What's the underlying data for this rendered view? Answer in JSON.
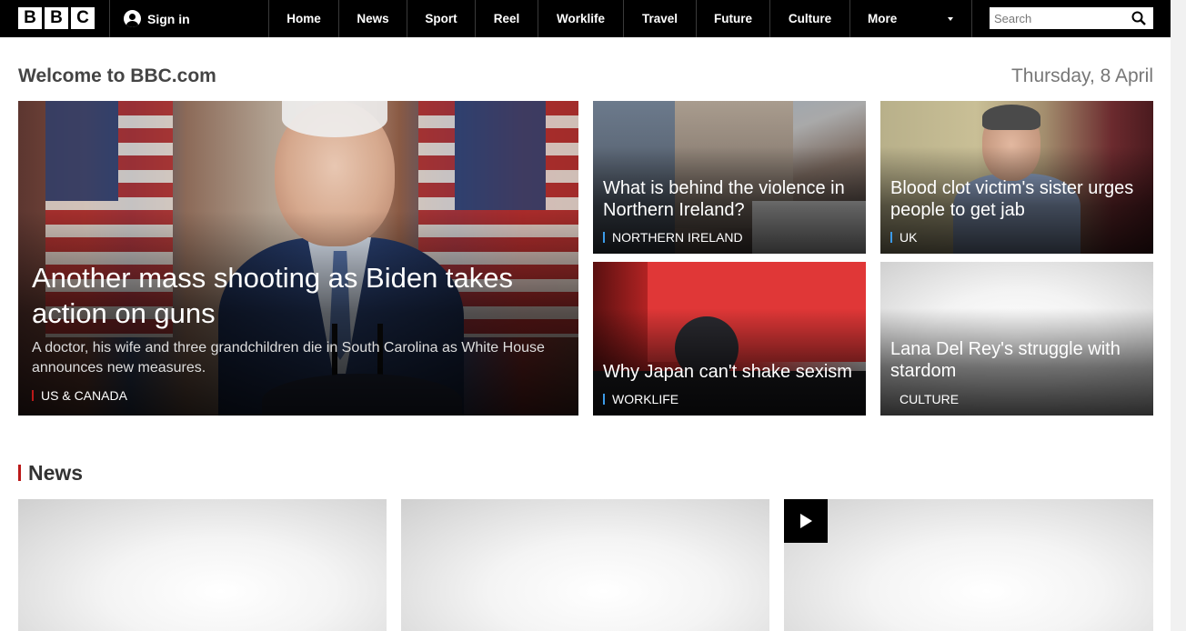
{
  "header": {
    "logo_letters": [
      "B",
      "B",
      "C"
    ],
    "signin_label": "Sign in",
    "nav": [
      "Home",
      "News",
      "Sport",
      "Reel",
      "Worklife",
      "Travel",
      "Future",
      "Culture",
      "More"
    ],
    "search_placeholder": "Search"
  },
  "welcome": {
    "title": "Welcome to BBC.com",
    "date": "Thursday, 8 April"
  },
  "hero": {
    "title": "Another mass shooting as Biden takes action on guns",
    "summary": "A doctor, his wife and three grandchildren die in South Carolina as White House announces new measures.",
    "tag": "US & CANADA",
    "tag_color": "#bb1919"
  },
  "tiles": [
    {
      "title": "What is behind the violence in Northern Ireland?",
      "tag": "NORTHERN IRELAND",
      "tag_color": "#3c9be8"
    },
    {
      "title": "Blood clot victim's sister urges people to get jab",
      "tag": "UK",
      "tag_color": "#3c9be8"
    },
    {
      "title": "Why Japan can't shake sexism",
      "tag": "WORKLIFE",
      "tag_color": "#3c9be8"
    },
    {
      "title": "Lana Del Rey's struggle with stardom",
      "tag": "CULTURE",
      "tag_color": "transparent"
    }
  ],
  "news_section": {
    "heading": "News",
    "accent": "#bb1919"
  }
}
